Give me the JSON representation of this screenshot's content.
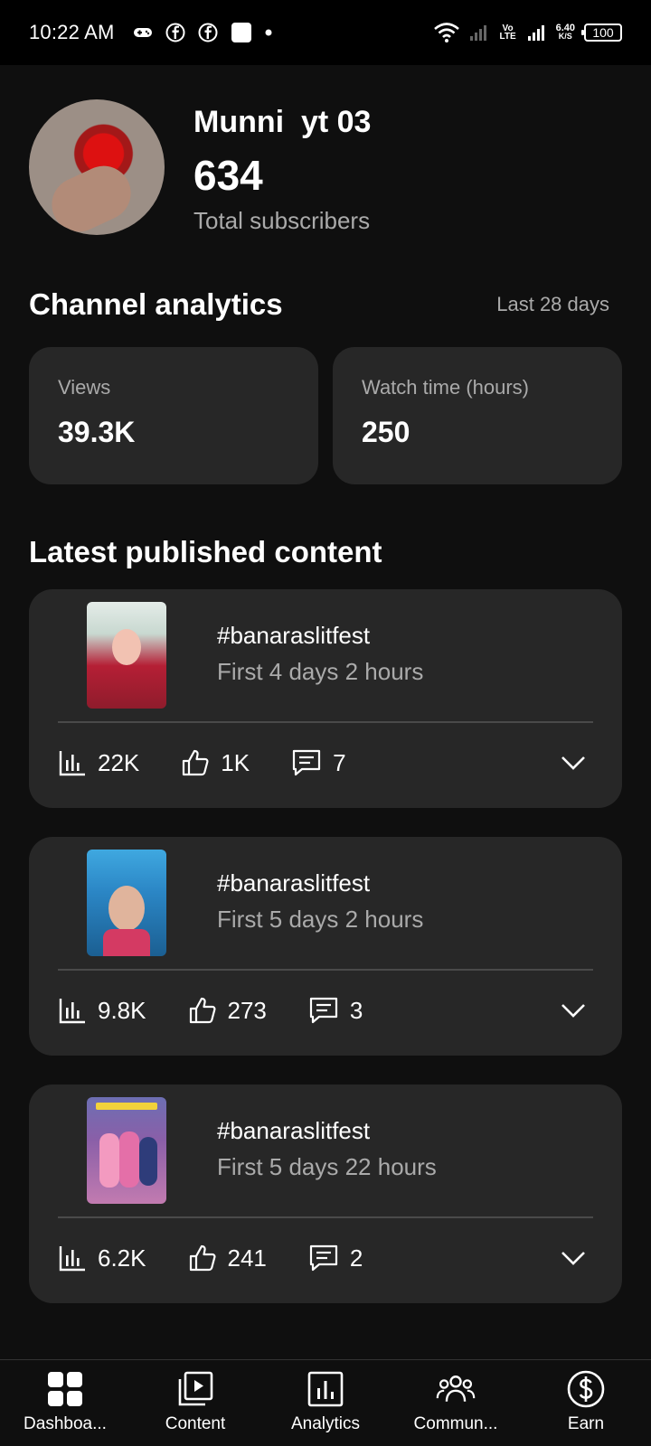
{
  "status_bar": {
    "time": "10:22 AM",
    "volte": "Vo LTE",
    "speed": "6.40",
    "speed_unit": "K/S",
    "battery": "100"
  },
  "channel": {
    "name": "Munni  yt 03",
    "subscribers": "634",
    "subscribers_label": "Total subscribers"
  },
  "analytics": {
    "title": "Channel analytics",
    "period": "Last 28 days",
    "stats": [
      {
        "label": "Views",
        "value": "39.3K"
      },
      {
        "label": "Watch time (hours)",
        "value": "250"
      }
    ]
  },
  "latest": {
    "title": "Latest published content",
    "videos": [
      {
        "title": "#banaraslitfest",
        "period": "First 4 days 2 hours",
        "views": "22K",
        "likes": "1K",
        "comments": "7"
      },
      {
        "title": "#banaraslitfest",
        "period": "First 5 days 2 hours",
        "views": "9.8K",
        "likes": "273",
        "comments": "3"
      },
      {
        "title": "#banaraslitfest",
        "period": "First 5 days 22 hours",
        "views": "6.2K",
        "likes": "241",
        "comments": "2"
      }
    ]
  },
  "nav": {
    "items": [
      {
        "label": "Dashboa...",
        "icon": "dashboard-icon"
      },
      {
        "label": "Content",
        "icon": "content-icon"
      },
      {
        "label": "Analytics",
        "icon": "analytics-icon"
      },
      {
        "label": "Commun...",
        "icon": "community-icon"
      },
      {
        "label": "Earn",
        "icon": "earn-icon"
      }
    ]
  }
}
